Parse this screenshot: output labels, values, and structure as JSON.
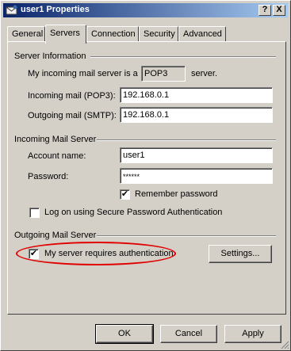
{
  "window": {
    "title": "user1 Properties",
    "help_label": "?",
    "close_label": "X"
  },
  "tabs": [
    {
      "label": "General"
    },
    {
      "label": "Servers",
      "active": true
    },
    {
      "label": "Connection"
    },
    {
      "label": "Security"
    },
    {
      "label": "Advanced"
    }
  ],
  "server_info": {
    "heading": "Server Information",
    "incoming_type_prefix": "My incoming mail server is a",
    "incoming_type_value": "POP3",
    "incoming_type_suffix": "server.",
    "incoming_label": "Incoming mail (POP3):",
    "incoming_value": "192.168.0.1",
    "outgoing_label": "Outgoing mail (SMTP):",
    "outgoing_value": "192.168.0.1"
  },
  "incoming_server": {
    "heading": "Incoming Mail Server",
    "account_label": "Account name:",
    "account_value": "user1",
    "password_label": "Password:",
    "password_value": "******",
    "remember_label": "Remember password",
    "remember_checked": true,
    "spa_label": "Log on using Secure Password Authentication",
    "spa_checked": false
  },
  "outgoing_server": {
    "heading": "Outgoing Mail Server",
    "auth_label": "My server requires authentication",
    "auth_checked": true,
    "settings_label": "Settings..."
  },
  "footer": {
    "ok_label": "OK",
    "cancel_label": "Cancel",
    "apply_label": "Apply"
  },
  "colors": {
    "highlight_ellipse": "#e00000",
    "titlebar": "#0a246a"
  }
}
